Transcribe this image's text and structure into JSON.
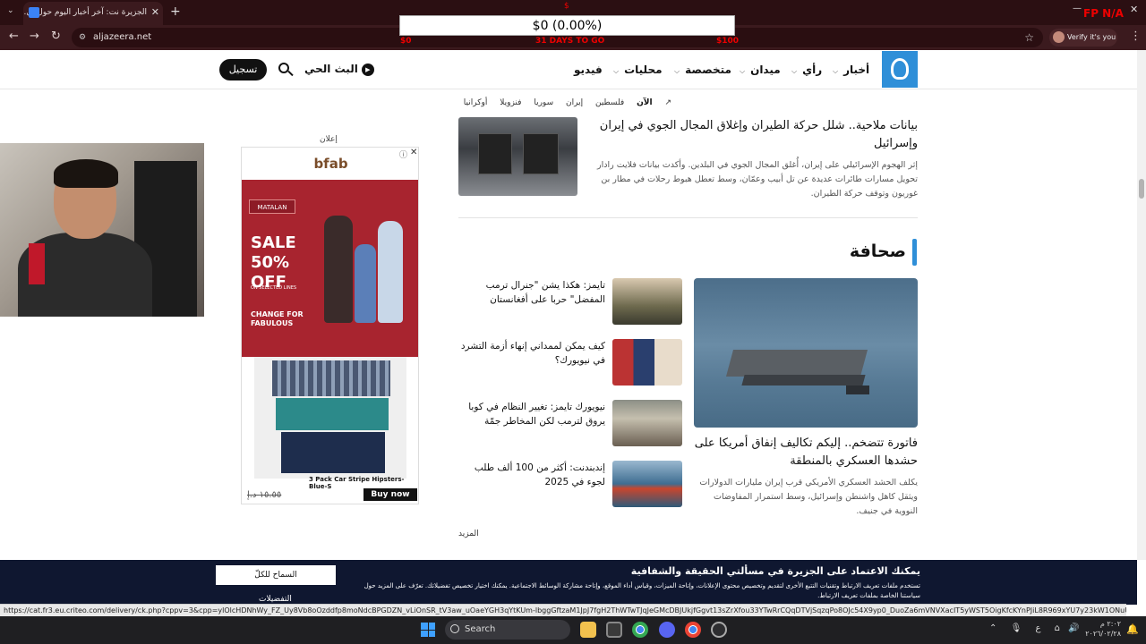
{
  "browser": {
    "tab_title": "الجزيرة نت: آخر أخبار اليوم حول ال...",
    "tab_close": "✕",
    "new_tab": "+",
    "url": "aljazeera.net",
    "verify_label": "Verify it's you"
  },
  "overlay": {
    "amount": "$0 (0.00%)",
    "top_marker": "$",
    "left_value": "$0",
    "middle_label": "31 DAYS TO GO",
    "right_value": "$100",
    "corner_label": "FP N/A"
  },
  "site": {
    "menu": [
      "أخبار",
      "رأي",
      "ميدان",
      "متخصصة",
      "محليات",
      "فيديو"
    ],
    "live_label": "البث الحي",
    "signup_label": "تسجيل",
    "trending": {
      "now_label": "الآن",
      "items": [
        "فلسطين",
        "إيران",
        "سوريا",
        "فنزويلا",
        "أوكرانيا"
      ]
    }
  },
  "article_top": {
    "title": "بيانات ملاحية.. شلل حركة الطيران وإغلاق المجال الجوي في إيران وإسرائيل",
    "description": "إثر الهجوم الإسرائيلي على إيران، أُغلق المجال الجوي في البلدين. وأكدت بيانات فلايت رادار تحويل مسارات طائرات عديدة عن تل أبيب وعمّان، وسط تعطل هبوط رحلات في مطار بن غوريون وتوقف حركة الطيران."
  },
  "section": {
    "title": "صحافة",
    "main": {
      "title": "فاتورة تتضخم.. إليكم تكاليف إنفاق أمريكا على حشدها العسكري بالمنطقة",
      "description": "يكلف الحشد العسكري الأمريكي قرب إيران مليارات الدولارات ويثقل كاهل واشنطن وإسرائيل، وسط استمرار المفاوضات النووية في جنيف."
    },
    "items": [
      {
        "title": "تايمز: هكذا يشن \"جنرال ترمب المفضل\" حربا على أفغانستان"
      },
      {
        "title": "كيف يمكن لممداني إنهاء أزمة التشرد في نيويورك؟"
      },
      {
        "title": "نيويورك تايمز: تغيير النظام في كوبا يروق لترمب لكن المخاطر جمّة"
      },
      {
        "title": "إندبندنت: أكثر من 100 ألف طلب لجوء في 2025"
      }
    ],
    "more_label": "المزيد"
  },
  "ad": {
    "label": "إعلان",
    "brand": "bfab",
    "store": "MATALAN",
    "sale_text": "SALE 50% OFF",
    "sale_sub": "ON SELECTED LINES",
    "tagline": "CHANGE FOR FABULOUS",
    "product_name": "3 Pack Car Stripe Hipsters-Blue-S",
    "price": "١٥.٥٥ د.إ",
    "buy_label": "Buy now",
    "info_icon": "ⓘ",
    "close_icon": "✕"
  },
  "cookie": {
    "title": "يمكنك الاعتماد على الجزيرة في مسألتي الحقيقة والشفافية",
    "text": "تستخدم ملفات تعريف الارتباط وتقنيات التتبع الأخرى لتقديم وتخصيص محتوى الإعلانات، وإتاحة الميزات، وقياس أداء الموقع، وإتاحة مشاركة الوسائط الاجتماعية. يمكنك اختيار تخصيص تفضيلاتك. تعرّف على المزيد حول سياستنا الخاصة بملفات تعريف الارتباط.",
    "allow_label": "السماح للكلّ",
    "prefs_label": "التفضيلات"
  },
  "status_url": "https://cat.fr3.eu.criteo.com/delivery/ck.php?cppv=3&cpp=ylOlcHDNhWy_FZ_Uy8Vb8oOzddfp8moNdcBPGDZN_vLiOnSR_tV3aw_uOaeYGH3qYtKUm-lbggGftzaM1JpJ7fgH2ThWTwTJqJeGMcDBJUkjfGgvt13sZrXfou33YTwRrCQqDTVjSqzqPo8OJc54X9yp0_DuoZa6mVNVXacIT5yWST5OigKfcKYnPJiL8R969xYU7y23kW1ONuUWodFChAcuTfHceLnYxMmt-6Vc-...",
  "taskbar": {
    "search_label": "Search",
    "tray_text": "ع",
    "time": "٢:٠٢ م",
    "date": "٢٠٢٦/٠٢/٢٨"
  }
}
